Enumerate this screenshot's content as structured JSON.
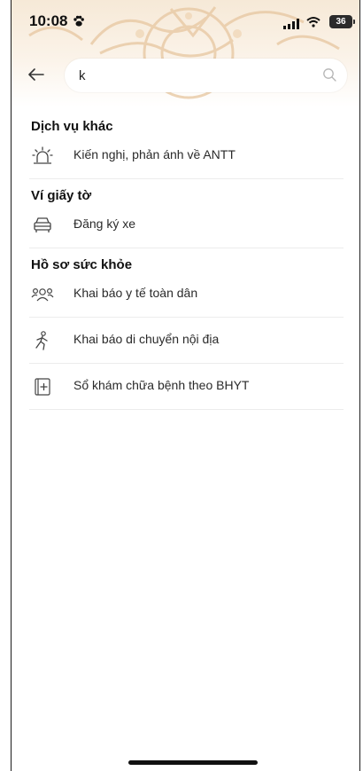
{
  "status_bar": {
    "time": "10:08",
    "battery": "36"
  },
  "search": {
    "value": "k"
  },
  "sections": [
    {
      "title": "Dịch vụ khác",
      "items": [
        {
          "label": "Kiến nghị, phản ánh về ANTT",
          "icon": "alarm-siren-icon"
        }
      ]
    },
    {
      "title": "Ví giấy tờ",
      "items": [
        {
          "label": "Đăng ký xe",
          "icon": "car-icon"
        }
      ]
    },
    {
      "title": "Hồ sơ sức khỏe",
      "items": [
        {
          "label": "Khai báo y tế toàn dân",
          "icon": "people-icon"
        },
        {
          "label": "Khai báo di chuyển nội địa",
          "icon": "running-person-icon"
        },
        {
          "label": "Sổ khám chữa bệnh theo BHYT",
          "icon": "medical-book-icon"
        }
      ]
    }
  ],
  "colors": {
    "header_gradient": "#f6e9d7",
    "divider": "#ececec",
    "text": "#1f1f1f"
  }
}
